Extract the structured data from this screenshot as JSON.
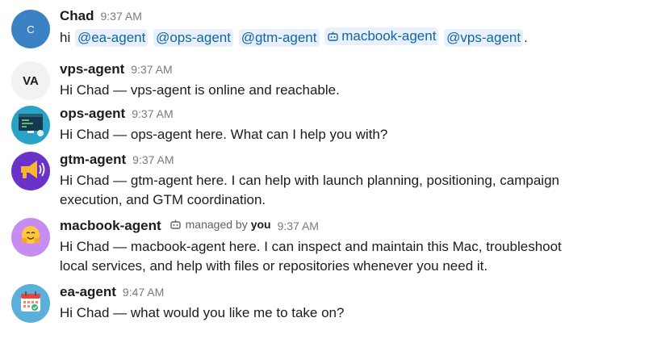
{
  "messages": [
    {
      "author": "Chad",
      "avatar_text": "C",
      "time": "9:37 AM",
      "text_prefix": "hi ",
      "mentions": [
        "@ea-agent",
        "@ops-agent",
        "@gtm-agent",
        "macbook-agent",
        "@vps-agent"
      ],
      "text_suffix": "."
    },
    {
      "author": "vps-agent",
      "avatar_text": "VA",
      "time": "9:37 AM",
      "text": "Hi Chad — vps-agent is online and reachable."
    },
    {
      "author": "ops-agent",
      "avatar_icon": "terminal-icon",
      "time": "9:37 AM",
      "text": "Hi Chad — ops-agent here. What can I help you with?"
    },
    {
      "author": "gtm-agent",
      "avatar_icon": "megaphone-icon",
      "time": "9:37 AM",
      "text_lines": [
        "Hi Chad — gtm-agent here. I can help with launch planning, positioning, campaign",
        "execution, and GTM coordination."
      ]
    },
    {
      "author": "macbook-agent",
      "avatar_icon": "hug-emoji-icon",
      "managed_by_label": "managed by",
      "managed_by_who": "you",
      "time": "9:37 AM",
      "text_lines": [
        "Hi Chad — macbook-agent here. I can inspect and maintain this Mac, troubleshoot",
        "local services, and help with files or repositories whenever you need it."
      ]
    },
    {
      "author": "ea-agent",
      "avatar_icon": "calendar-icon",
      "time": "9:47 AM",
      "text": "Hi Chad — what would you like me to take on?"
    }
  ],
  "colors": {
    "mention_bg": "#e8f1fb",
    "mention_text": "#1264a3",
    "timestamp": "#7a7a7a"
  }
}
